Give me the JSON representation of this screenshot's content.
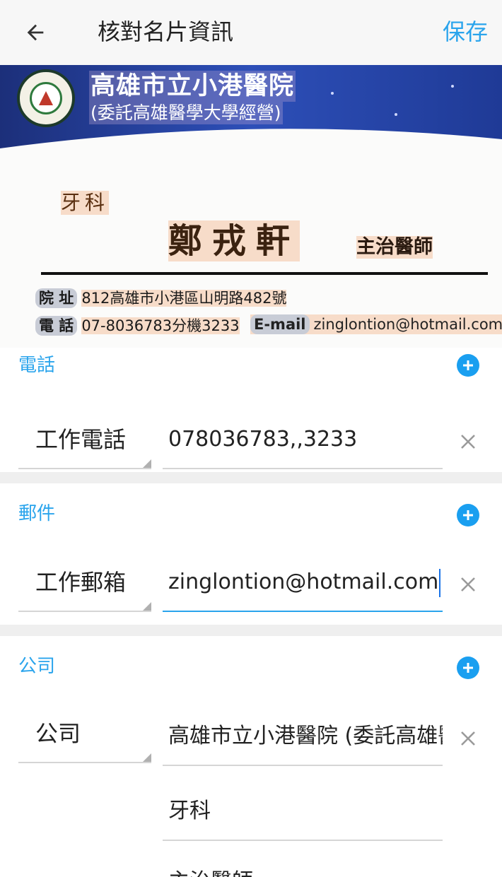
{
  "appbar": {
    "back_icon": "arrow-left-icon",
    "title": "核對名片資訊",
    "save_label": "保存",
    "accent_color": "#2aa4ec"
  },
  "card_image": {
    "hospital_name": "高雄市立小港醫院",
    "hospital_sub": "(委託高雄醫學大學經營)",
    "department": "牙科",
    "person_name": "鄭戎軒",
    "person_title": "主治醫師",
    "address_tag": "院 址",
    "address": "812高雄市小港區山明路482號",
    "phone_tag": "電 話",
    "phone": "07-8036783分機3233",
    "email_tag": "E-mail",
    "email": "zinglontion@hotmail.com"
  },
  "phone_section": {
    "title": "電話",
    "rows": [
      {
        "type": "工作電話",
        "value": "078036783,,3233"
      }
    ]
  },
  "email_section": {
    "title": "郵件",
    "rows": [
      {
        "type": "工作郵箱",
        "value": "zinglontion@hotmail.com"
      }
    ]
  },
  "company_section": {
    "title": "公司",
    "type": "公司",
    "company_value": "高雄市立小港醫院 (委託高雄醫學大學經營)",
    "department_value": "牙科",
    "title_value": "主治醫師"
  }
}
